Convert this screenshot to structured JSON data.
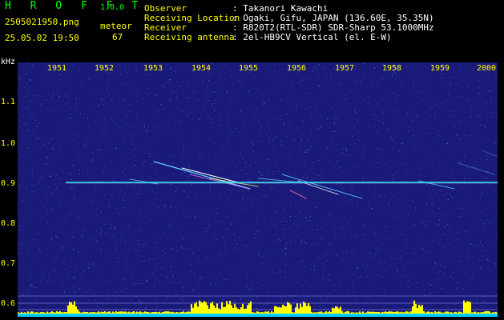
{
  "header": {
    "app_name": "H R O F F T",
    "app_version": "1.0.0",
    "file_name": "2505021950.png",
    "timestamp": "25.05.02 19:50",
    "count_label": "meteor",
    "count_value": "67",
    "info": [
      {
        "label": "Observer",
        "value": ": Takanori Kawachi"
      },
      {
        "label": "Receiving Location",
        "value": ": Ogaki, Gifu, JAPAN (136.60E, 35.35N)"
      },
      {
        "label": "Receiver",
        "value": ": R820T2(RTL-SDR) SDR-Sharp 53.1000MHz"
      },
      {
        "label": "Receiving antenna",
        "value": ": 2el-HB9CV Vertical (el. E-W)"
      }
    ]
  },
  "axes": {
    "unit_label": "kHz",
    "y_ticks": [
      "1.1",
      "1.0",
      "0.9",
      "0.8",
      "0.7",
      "0.6"
    ],
    "x_ticks": [
      "1951",
      "1952",
      "1953",
      "1954",
      "1955",
      "1956",
      "1957",
      "1958",
      "1959",
      "2000"
    ]
  },
  "colors": {
    "background": "#1a1a78",
    "carrier": "#33ddff",
    "tick_text": "#ffff00",
    "header_green": "#00ff00",
    "baseline": "#00ccff",
    "activity": "#ffff00"
  }
}
